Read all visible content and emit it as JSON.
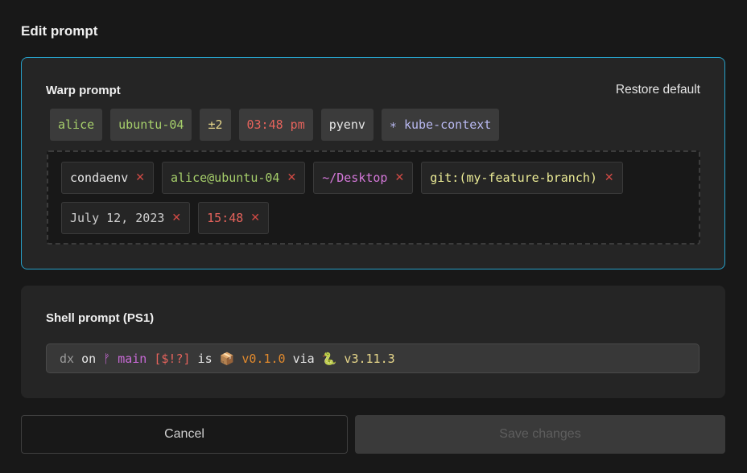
{
  "title": "Edit prompt",
  "warp": {
    "label": "Warp prompt",
    "restore_label": "Restore default",
    "available_chips": [
      {
        "text": "alice",
        "color": "#a6cf6b"
      },
      {
        "text": "ubuntu-04",
        "color": "#a6cf6b"
      },
      {
        "text": "±2",
        "color": "#e6d68a"
      },
      {
        "text": "03:48 pm",
        "color": "#e5635c"
      },
      {
        "text": "pyenv",
        "color": "#e6e6e6"
      },
      {
        "text": "∗ kube-context",
        "color": "#b9b9f2"
      }
    ],
    "selected_chips": [
      {
        "text": "condaenv",
        "color": "#e6e6e6"
      },
      {
        "text": "alice@ubuntu-04",
        "color": "#a6cf6b"
      },
      {
        "text": "~/Desktop",
        "color": "#d478d9"
      },
      {
        "text": "git:(my-feature-branch)",
        "color": "#ecec96"
      },
      {
        "text": "July 12, 2023",
        "color": "#cfcfcf"
      },
      {
        "text": "15:48",
        "color": "#e5635c"
      }
    ],
    "remove_glyph": "✕"
  },
  "shell": {
    "label": "Shell prompt (PS1)",
    "segments": [
      {
        "text": "dx",
        "color": "#9a9a9a"
      },
      {
        "text": " on ",
        "color": "#e6e6e6"
      },
      {
        "text": "ᚠ main",
        "color": "#c86ad6"
      },
      {
        "text": " ",
        "color": "#e6e6e6"
      },
      {
        "text": "[$!?]",
        "color": "#e5635c"
      },
      {
        "text": " is ",
        "color": "#e6e6e6"
      },
      {
        "text": "📦 v0.1.0",
        "color": "#e0892d"
      },
      {
        "text": " via ",
        "color": "#e6e6e6"
      },
      {
        "text": "🐍 v3.11.3",
        "color": "#e6d68a"
      }
    ]
  },
  "buttons": {
    "cancel_label": "Cancel",
    "save_label": "Save changes"
  }
}
